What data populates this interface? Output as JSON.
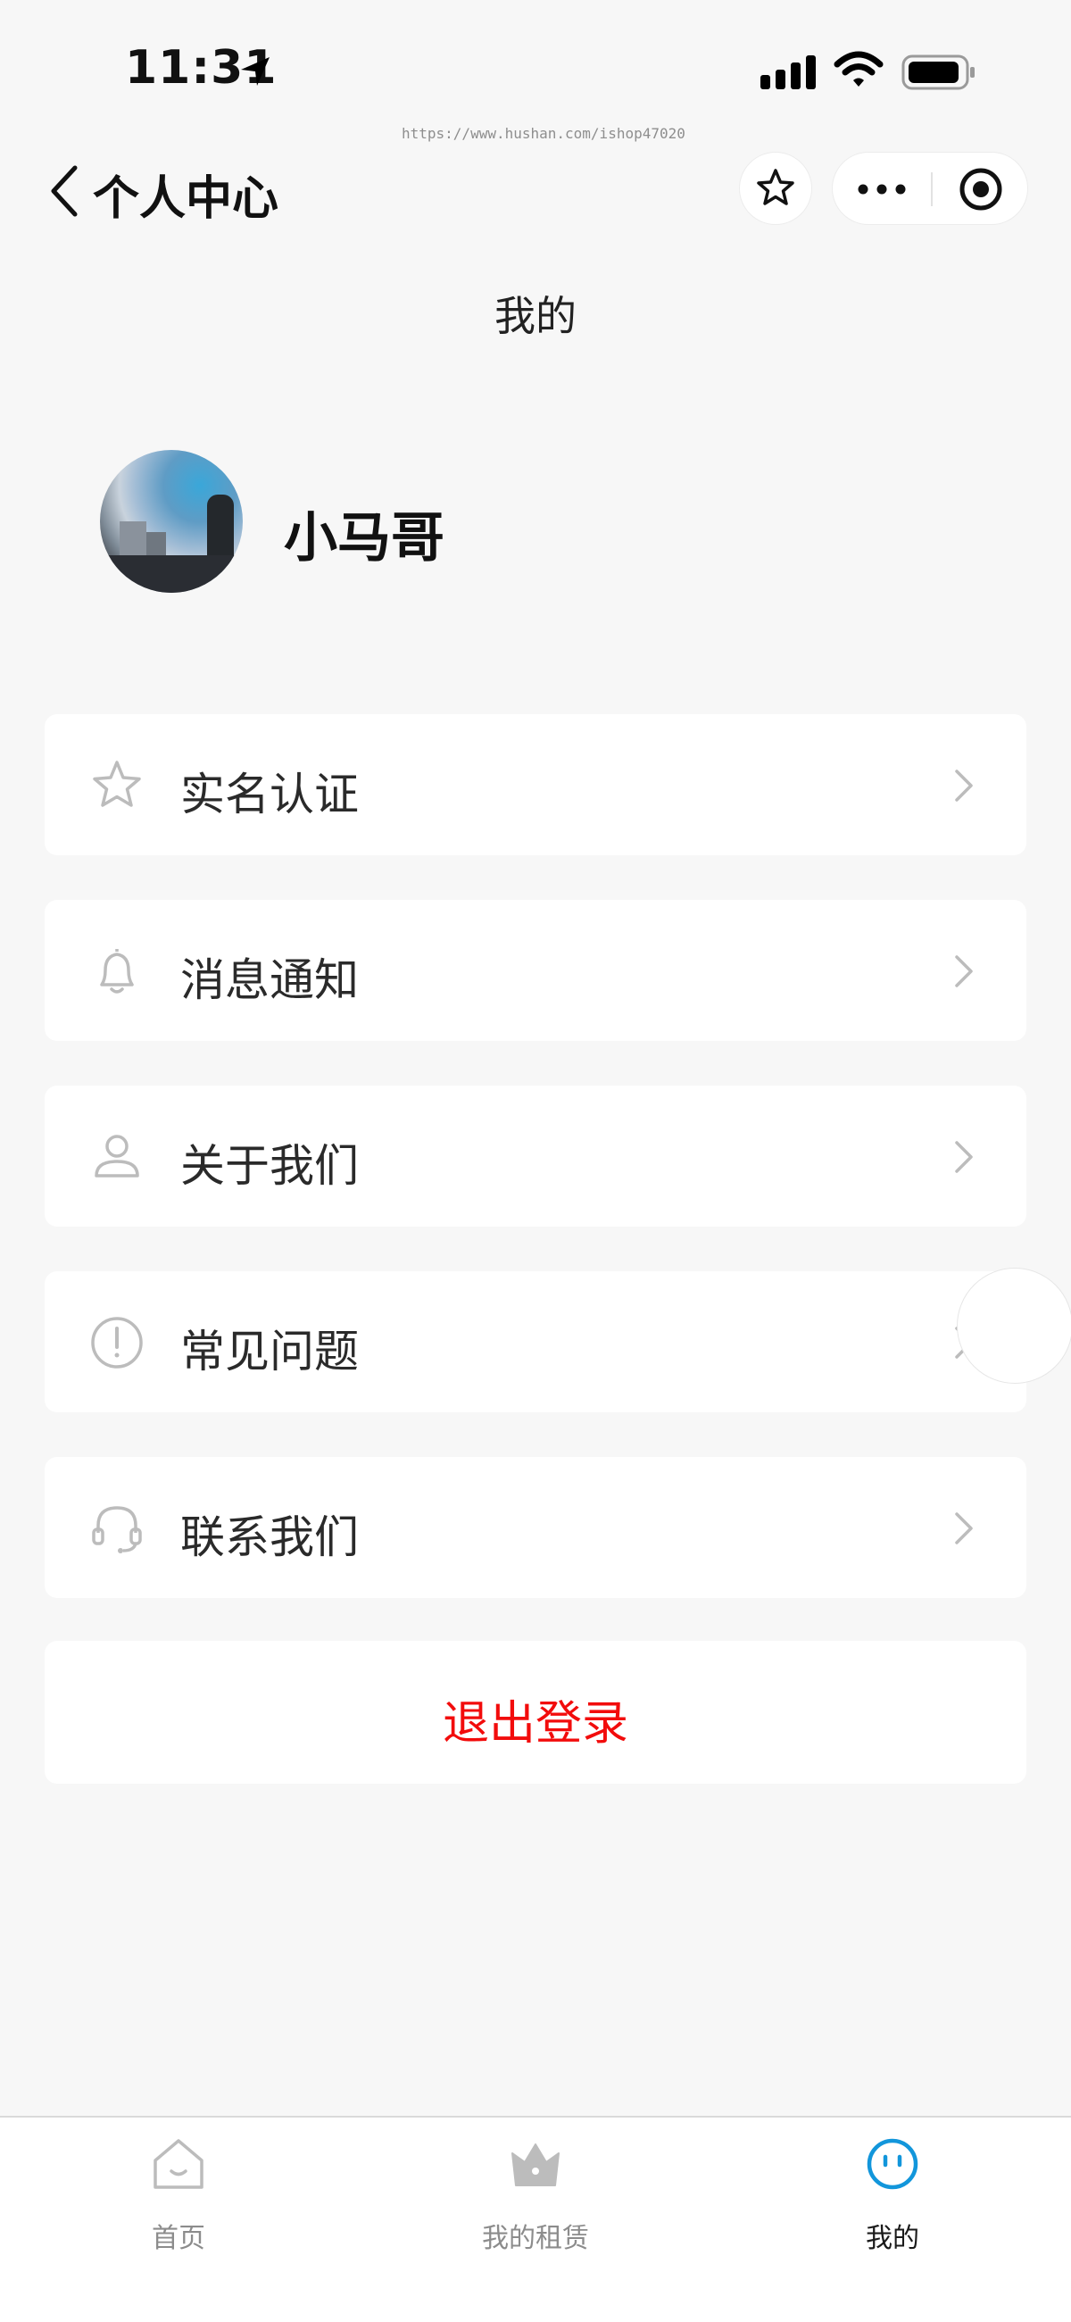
{
  "status_bar": {
    "time": "11:31"
  },
  "watermark": "https://www.hushan.com/ishop47020",
  "nav": {
    "title": "个人中心"
  },
  "page_title": "我的",
  "profile": {
    "username": "小马哥"
  },
  "menu": [
    {
      "label": "实名认证",
      "icon": "star-icon"
    },
    {
      "label": "消息通知",
      "icon": "bell-icon"
    },
    {
      "label": "关于我们",
      "icon": "person-icon"
    },
    {
      "label": "常见问题",
      "icon": "info-icon"
    },
    {
      "label": "联系我们",
      "icon": "headset-icon"
    }
  ],
  "logout": {
    "label": "退出登录",
    "color": "#f20c0c"
  },
  "tabs": [
    {
      "label": "首页",
      "icon": "home-icon",
      "active": false
    },
    {
      "label": "我的租赁",
      "icon": "crown-icon",
      "active": false
    },
    {
      "label": "我的",
      "icon": "smile-face-icon",
      "active": true
    }
  ],
  "colors": {
    "accent": "#1296db",
    "background": "#f7f7f7",
    "icon_gray": "#bcbcbc"
  }
}
